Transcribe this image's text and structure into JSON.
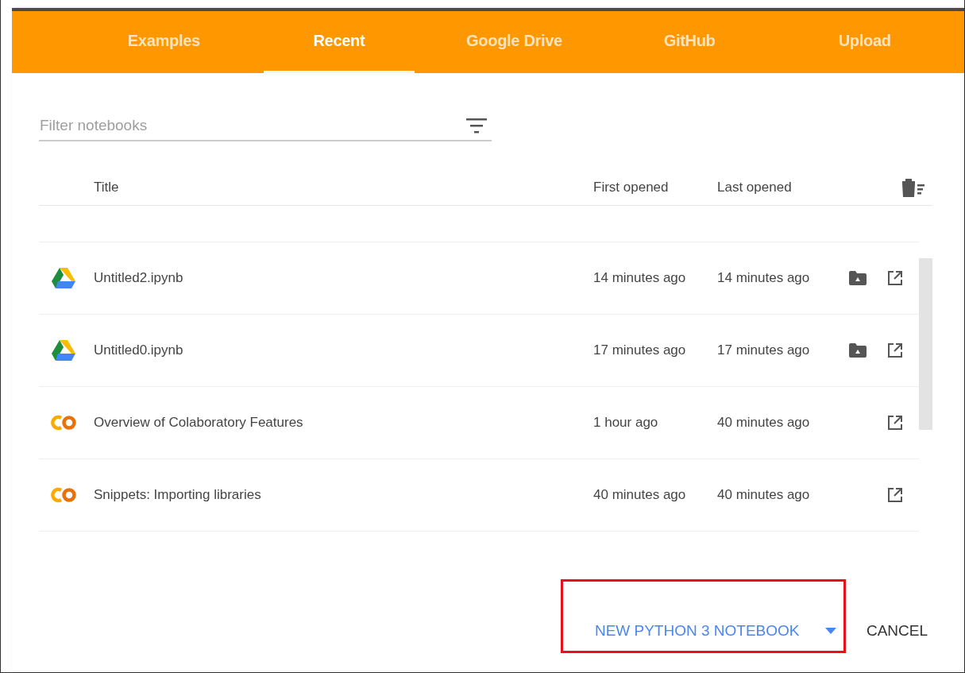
{
  "tabs": [
    {
      "label": "Examples",
      "selected": false
    },
    {
      "label": "Recent",
      "selected": true
    },
    {
      "label": "Google Drive",
      "selected": false
    },
    {
      "label": "GitHub",
      "selected": false
    },
    {
      "label": "Upload",
      "selected": false
    }
  ],
  "filter": {
    "placeholder": "Filter notebooks"
  },
  "table": {
    "columns": [
      "Title",
      "First opened",
      "Last opened"
    ],
    "rows": [
      {
        "kind": "drive",
        "title": "Untitled2.ipynb",
        "first_opened": "14 minutes ago",
        "last_opened": "14 minutes ago",
        "in_drive_folder": true
      },
      {
        "kind": "drive",
        "title": "Untitled0.ipynb",
        "first_opened": "17 minutes ago",
        "last_opened": "17 minutes ago",
        "in_drive_folder": true
      },
      {
        "kind": "colab",
        "title": "Overview of Colaboratory Features",
        "first_opened": "1 hour ago",
        "last_opened": "40 minutes ago",
        "in_drive_folder": false
      },
      {
        "kind": "colab",
        "title": "Snippets: Importing libraries",
        "first_opened": "40 minutes ago",
        "last_opened": "40 minutes ago",
        "in_drive_folder": false
      }
    ]
  },
  "footer": {
    "new_notebook": {
      "label": "NEW PYTHON 3 NOTEBOOK",
      "highlighted": true
    },
    "cancel": "CANCEL"
  }
}
